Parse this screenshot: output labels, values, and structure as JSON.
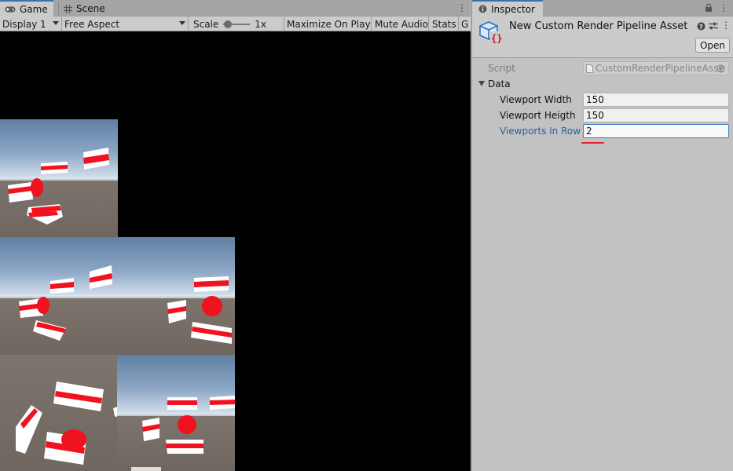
{
  "game_panel": {
    "tabs": [
      {
        "label": "Game",
        "icon": "gamepad-icon",
        "active": true
      },
      {
        "label": "Scene",
        "icon": "grid-icon",
        "active": false
      }
    ],
    "toolbar": {
      "display": "Display 1",
      "aspect": "Free Aspect",
      "scale_label": "Scale",
      "scale_value": "1x",
      "maximize": "Maximize On Play",
      "mute": "Mute Audio",
      "stats": "Stats",
      "gizmos": "G"
    },
    "viewports_in_row": 2,
    "viewport_count": 5,
    "colors": {
      "sky_top": "#5f7fa3",
      "sky_bottom": "#dfe9f3",
      "ground": "#756c65",
      "object_red": "#f0121e",
      "object_white": "#ffffff"
    }
  },
  "inspector": {
    "tab_label": "Inspector",
    "tab_icon": "info-icon",
    "header_icons": [
      "lock-icon",
      "kebab-menu-icon"
    ],
    "asset_icon": "scriptable-object-icon",
    "asset_title": "New Custom Render Pipeline Asset (",
    "header_tool_icons": [
      "help-icon",
      "preset-sliders-icon",
      "kebab-menu-icon"
    ],
    "open_button": "Open",
    "script": {
      "label": "Script",
      "value": "CustomRenderPipelineAsse"
    },
    "data_section": {
      "label": "Data",
      "fields": [
        {
          "label": "Viewport Width",
          "value": "150"
        },
        {
          "label": "Viewport Heigth",
          "value": "150"
        },
        {
          "label": "Viewports In Row",
          "value": "2",
          "focused": true
        }
      ]
    },
    "colors": {
      "focus_label": "#2a5ea6",
      "focus_border": "#3d7cc4",
      "annotation_red": "#e3262e"
    }
  }
}
